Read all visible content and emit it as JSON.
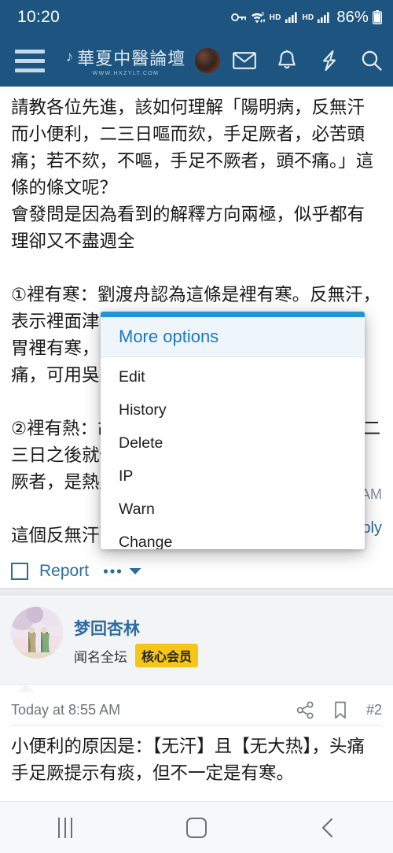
{
  "statusbar": {
    "time": "10:20",
    "icons": [
      "vpn-key-icon",
      "wifi-6-icon",
      "hd-badge",
      "signal-bars-icon",
      "hd-badge",
      "signal-bars-icon"
    ],
    "hd_label_1": "HD",
    "hd_label_2": "HD",
    "battery_percent": "86%"
  },
  "appbar": {
    "background": "#1d5580",
    "menu_icon": "hamburger-menu-icon",
    "brand_title": "華夏中醫論壇",
    "brand_url": "WWW.HXZYLT.COM",
    "avatar": "user-avatar",
    "icons": [
      {
        "name": "inbox-icon",
        "label": "Inbox"
      },
      {
        "name": "alerts-bell-icon",
        "label": "Alerts"
      },
      {
        "name": "whats-new-bolt-icon",
        "label": "What's new"
      },
      {
        "name": "search-icon",
        "label": "Search"
      }
    ]
  },
  "post1": {
    "paragraphs": [
      "請教各位先進，該如何理解「陽明病，反無汗而小便利，二三日嘔而欬，手足厥者，必苦頭痛；若不欬，不嘔，手足不厥者，頭不痛。」這條的條文呢？",
      "會發問是因為看到的解釋方向兩極，似乎都有理卻又不盡週全",
      "①裡有寒：劉渡舟認為這條是裡有寒。反無汗，表示裡面津液虛了。小便利表示裡沒有濕邪。胃裡有寒，胃氣也虛，寒就上逆，所以必頭痛，可用吳茱萸湯來治療。",
      "②裡有熱：胡希恕認為這條是裡有熱。陽明，二三日之後就傳裡了，熱就上攻。裡有熱，手足厥者，是熱厥，可用白虎湯或四逆散來治療。",
      "這個反無汗而小便利，該怎麼理解才合適呢？"
    ],
    "hidden_time_fragment": "AM",
    "hidden_reply_fragment": "ply",
    "actions": {
      "checkbox": "select-post-checkbox",
      "report_label": "Report",
      "more_icon": "more-dots-icon",
      "caret_icon": "chevron-down-icon"
    }
  },
  "dialog": {
    "title": "More options",
    "accent": "#2196d6",
    "items": [
      {
        "label": "Edit",
        "name": "menu-item-edit"
      },
      {
        "label": "History",
        "name": "menu-item-history"
      },
      {
        "label": "Delete",
        "name": "menu-item-delete"
      },
      {
        "label": "IP",
        "name": "menu-item-ip"
      },
      {
        "label": "Warn",
        "name": "menu-item-warn"
      },
      {
        "label": "Change",
        "name": "menu-item-change"
      }
    ]
  },
  "post2": {
    "username": "梦回杏林",
    "user_title": "闻名全坛",
    "user_badge": "核心会员",
    "badge_color": "#f5c518",
    "timestamp": "Today at 8:55 AM",
    "post_number": "#2",
    "icons": [
      {
        "name": "share-icon"
      },
      {
        "name": "bookmark-icon"
      }
    ],
    "body": "小便利的原因是：【无汗】且【无大热】，头痛手足厥提示有痰，但不一定是有寒。"
  },
  "navbar": {
    "recents": "recents-button",
    "home": "home-button",
    "back": "back-button"
  }
}
